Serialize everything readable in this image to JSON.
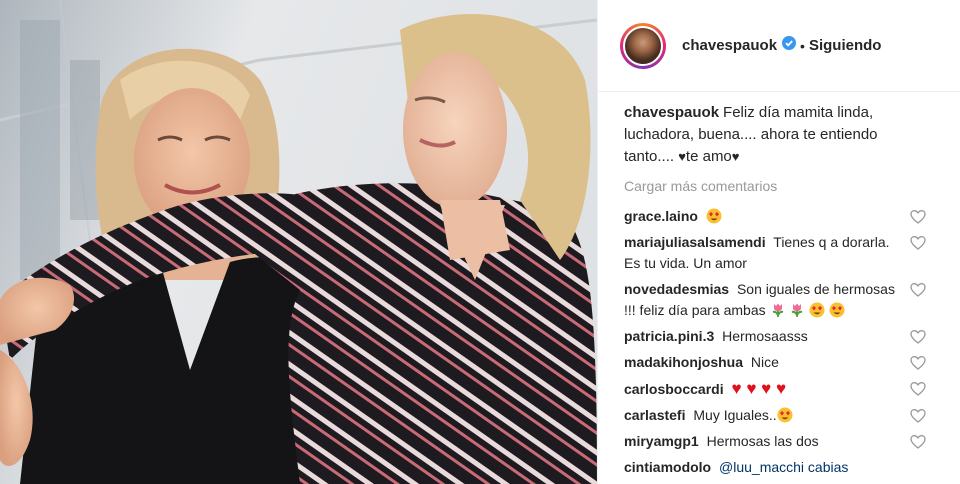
{
  "post": {
    "username": "chavespauok",
    "follow_status": "Siguiendo",
    "separator": "•",
    "caption": {
      "username": "chavespauok",
      "text_before": "Feliz día mamita linda, luchadora, buena.... ahora te entiendo tanto.... ",
      "heart_1": "♥",
      "text_mid": "te amo",
      "heart_2": "♥"
    },
    "load_more": "Cargar más comentarios"
  },
  "comments": [
    {
      "username": "grace.laino",
      "text": ""
    },
    {
      "username": "mariajuliasalsamendi",
      "text": "Tienes q a dorarla. Es tu vida. Un amor"
    },
    {
      "username": "novedadesmias",
      "text": "Son iguales de hermosas !!! feliz día para ambas"
    },
    {
      "username": "patricia.pini.3",
      "text": "Hermosaasss"
    },
    {
      "username": "madakihonjoshua",
      "text": "Nice"
    },
    {
      "username": "carlosboccardi",
      "text": "",
      "hearts": "♥ ♥ ♥ ♥"
    },
    {
      "username": "carlastefi",
      "text": "Muy Iguales.."
    },
    {
      "username": "miryamgp1",
      "text": "Hermosas las dos"
    },
    {
      "username": "cintiamodolo",
      "text": "@luu_macchi cabias"
    }
  ],
  "icons": {
    "verified": "verified-badge-icon",
    "like": "heart-outline-icon",
    "heart_eyes": "heart-eyes-emoji",
    "tulip": "tulip-emoji"
  },
  "colors": {
    "verified": "#3897f0",
    "muted_text": "#999999",
    "like_heart": "#e0101c"
  }
}
